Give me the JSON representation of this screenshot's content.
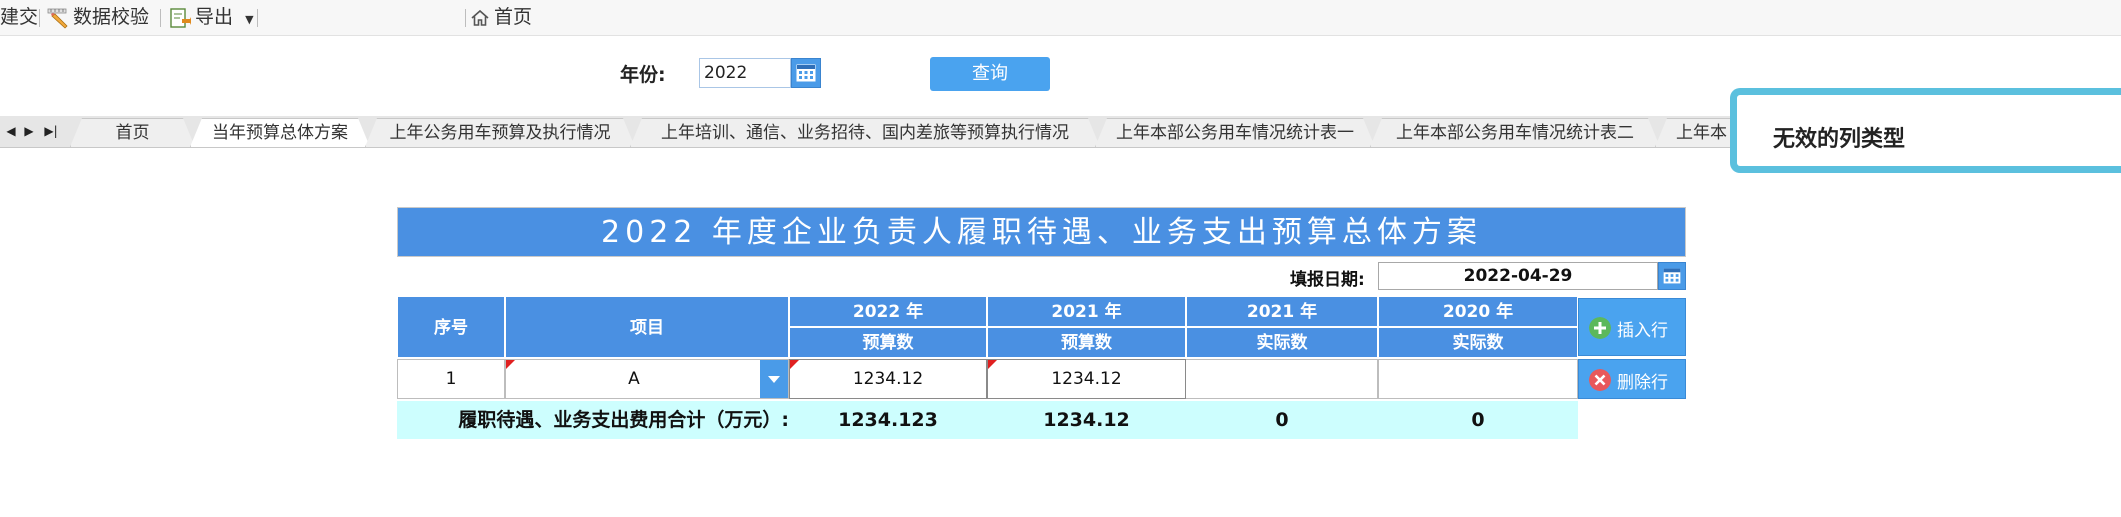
{
  "toolbar": {
    "submit_partial": "建交",
    "data_check": "数据校验",
    "export": "导出",
    "home": "首页"
  },
  "query": {
    "year_label": "年份:",
    "year_value": "2022",
    "query_button": "查询"
  },
  "tabs": [
    {
      "label": "首页",
      "active": false
    },
    {
      "label": "当年预算总体方案",
      "active": true
    },
    {
      "label": "上年公务用车预算及执行情况",
      "active": false
    },
    {
      "label": "上年培训、通信、业务招待、国内差旅等预算执行情况",
      "active": false
    },
    {
      "label": "上年本部公务用车情况统计表一",
      "active": false
    },
    {
      "label": "上年本部公务用车情况统计表二",
      "active": false
    },
    {
      "label": "上年本",
      "active": false
    }
  ],
  "toast": {
    "message": "无效的列类型"
  },
  "report": {
    "title": "2022 年度企业负责人履职待遇、业务支出预算总体方案",
    "date_label": "填报日期:",
    "date_value": "2022-04-29",
    "headers": {
      "seq": "序号",
      "item": "项目",
      "y2022": "2022 年",
      "y2022_sub": "预算数",
      "y2021a": "2021 年",
      "y2021a_sub": "预算数",
      "y2021b": "2021 年",
      "y2021b_sub": "实际数",
      "y2020": "2020 年",
      "y2020_sub": "实际数"
    },
    "rows": [
      {
        "seq": "1",
        "item": "A",
        "budget_2022": "1234.12",
        "budget_2021": "1234.12",
        "actual_2021": "",
        "actual_2020": ""
      }
    ],
    "summary": {
      "label": "履职待遇、业务支出费用合计（万元）:",
      "budget_2022": "1234.123",
      "budget_2021": "1234.12",
      "actual_2021": "0",
      "actual_2020": "0"
    },
    "buttons": {
      "insert_row": "插入行",
      "delete_row": "删除行"
    }
  },
  "colors": {
    "header_blue": "#4a90e2",
    "summary_cyan": "#cdfefe",
    "toast_border": "#5bc0de",
    "insert_icon": "#5cb85c",
    "delete_icon": "#e8585b"
  }
}
